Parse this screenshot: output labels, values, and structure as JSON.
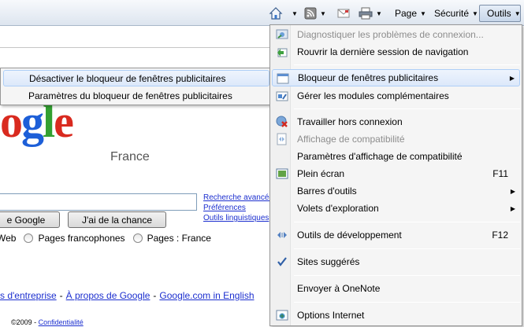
{
  "commandbar": {
    "page_label": "Page",
    "security_label": "Sécurité",
    "tools_label": "Outils"
  },
  "google": {
    "country": "France",
    "search_button": "e Google",
    "lucky_button": "J'ai de la chance",
    "side_links": [
      "Recherche avancée",
      "Préférences",
      "Outils linguistiques"
    ],
    "radio_options": [
      "Web",
      "Pages francophones",
      "Pages : France"
    ],
    "footer_links": [
      "s d'entreprise",
      "À propos de Google",
      "Google.com in English"
    ],
    "copyright": "©2009 - ",
    "privacy_link": "Confidentialité"
  },
  "tools_menu": {
    "items": [
      {
        "label": "Diagnostiquer les problèmes de connexion...",
        "disabled": true,
        "icon": "diagnose-icon"
      },
      {
        "label": "Rouvrir la dernière session de navigation",
        "icon": "reopen-session-icon"
      },
      {
        "label": "Bloqueur de fenêtres publicitaires",
        "submenu": true,
        "icon": "popup-blocker-icon"
      },
      {
        "label": "Gérer les modules complémentaires",
        "icon": "addons-icon"
      },
      {
        "label": "Travailler hors connexion",
        "icon": "offline-icon"
      },
      {
        "label": "Affichage de compatibilité",
        "disabled": true,
        "icon": "compat-view-icon"
      },
      {
        "label": "Paramètres d'affichage de compatibilité"
      },
      {
        "label": "Plein écran",
        "shortcut": "F11",
        "icon": "fullscreen-icon"
      },
      {
        "label": "Barres d'outils",
        "submenu": true
      },
      {
        "label": "Volets d'exploration",
        "submenu": true
      },
      {
        "label": "Outils de développement",
        "shortcut": "F12",
        "icon": "dev-tools-icon"
      },
      {
        "label": "Sites suggérés",
        "checked": true,
        "icon": "checkmark-icon"
      },
      {
        "label": "Envoyer à OneNote"
      },
      {
        "label": "Options Internet",
        "icon": "internet-options-icon"
      }
    ]
  },
  "popup_submenu": {
    "items": [
      {
        "label": "Désactiver le bloqueur de fenêtres publicitaires"
      },
      {
        "label": "Paramètres du bloqueur de fenêtres publicitaires"
      }
    ]
  }
}
